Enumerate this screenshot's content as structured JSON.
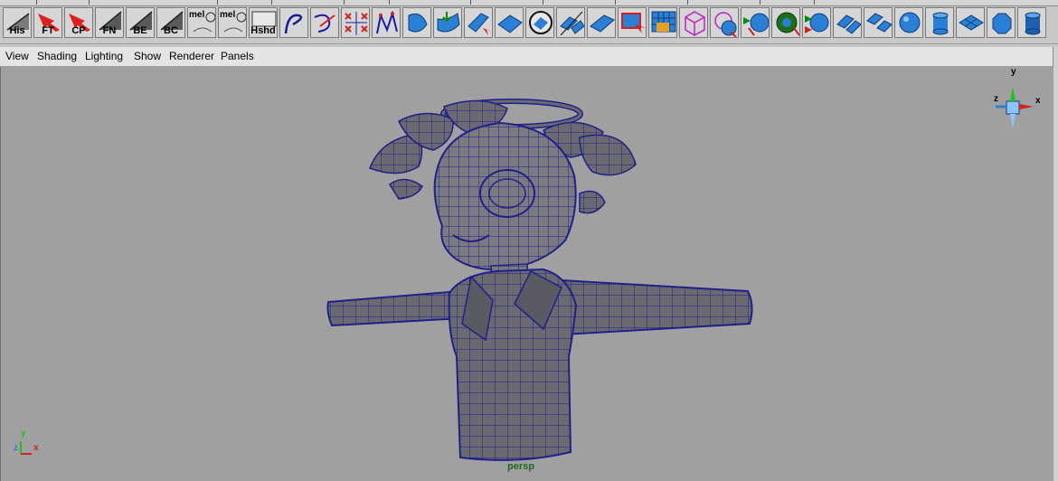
{
  "shelf": {
    "buttons": [
      {
        "id": "his",
        "label": "His"
      },
      {
        "id": "ft",
        "label": "FT"
      },
      {
        "id": "cp",
        "label": "CP"
      },
      {
        "id": "fn",
        "label": "FN"
      },
      {
        "id": "be",
        "label": "BE"
      },
      {
        "id": "bc",
        "label": "BC"
      },
      {
        "id": "mel1",
        "label": "mel"
      },
      {
        "id": "mel2",
        "label": "mel"
      },
      {
        "id": "hshd",
        "label": "Hshd"
      }
    ],
    "icons": [
      "curve-tool-icon",
      "curve-edit-icon",
      "cv-grid-icon",
      "curve-rebuild-icon",
      "revolve-icon",
      "loft-icon",
      "extrude-surface-icon",
      "planar-icon",
      "circle-select-icon",
      "split-poly-icon",
      "bevel-icon",
      "merge-icon",
      "poly-grid-icon",
      "cube-wire-icon",
      "sphere-wire-icon",
      "reduce-icon",
      "sphere-green-icon",
      "smooth-icon",
      "split-face-icon",
      "subdivide-icon",
      "plane-icon",
      "sphere-icon",
      "cylinder-icon",
      "grid-plane-icon",
      "dome-icon",
      "cylinder-blue-icon"
    ]
  },
  "menubar": {
    "items": [
      "View",
      "Shading",
      "Lighting",
      "Show",
      "Renderer",
      "Panels"
    ]
  },
  "viewport": {
    "camera_label": "persp",
    "view_cube_axes": {
      "x": "x",
      "y": "y",
      "z": "z"
    },
    "origin_axes": {
      "x": "x",
      "y": "y",
      "z": "z"
    }
  },
  "colors": {
    "viewport_bg": "#a0a0a0",
    "mesh_fill": "#6a6a70",
    "wire": "#20208a",
    "accent_red": "#d42020",
    "icon_blue": "#2a7fd6"
  }
}
